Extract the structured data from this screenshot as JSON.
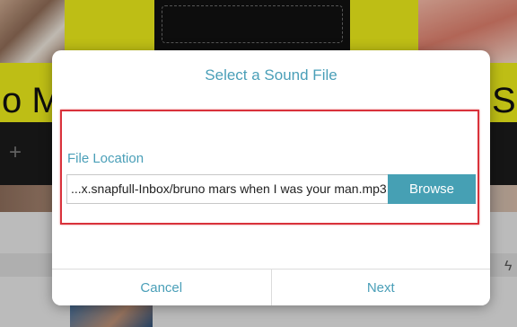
{
  "background": {
    "left_glyph": "o M",
    "right_glyph": "S",
    "plus_icon": "plus-icon",
    "bolt_icon": "bolt-icon"
  },
  "dialog": {
    "title": "Select a Sound File",
    "file_location_label": "File Location",
    "file_path_value": "...x.snapfull-Inbox/bruno mars when I was your man.mp3",
    "browse_label": "Browse",
    "cancel_label": "Cancel",
    "next_label": "Next"
  },
  "colors": {
    "accent": "#4a9fb8",
    "browse_button": "#46a0b4",
    "highlight_border": "#d9323b"
  }
}
